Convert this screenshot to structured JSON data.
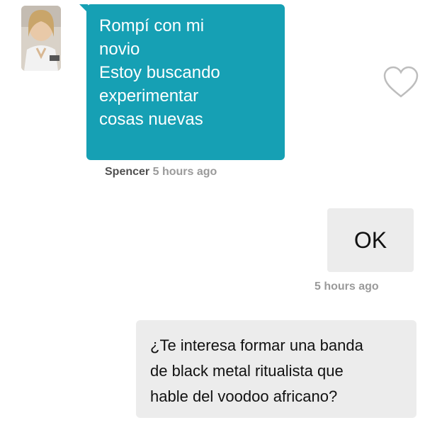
{
  "incoming_message": {
    "lines": [
      "Rompí con mi",
      "novio",
      "Estoy buscando",
      "experimentar",
      "cosas nuevas"
    ],
    "sender": "Spencer",
    "timestamp": "5 hours ago"
  },
  "outgoing_messages": [
    {
      "text": "OK",
      "timestamp": "5 hours ago"
    },
    {
      "lines": [
        "¿Te interesa formar una banda",
        "de black metal ritualista que",
        "hable del voodoo africano?"
      ]
    }
  ],
  "icons": {
    "like": "heart-icon",
    "avatar": "profile-photo"
  },
  "colors": {
    "incoming_bubble": "#16a0b4",
    "outgoing_bubble": "#ececec",
    "meta_text": "#9a9a9a"
  }
}
